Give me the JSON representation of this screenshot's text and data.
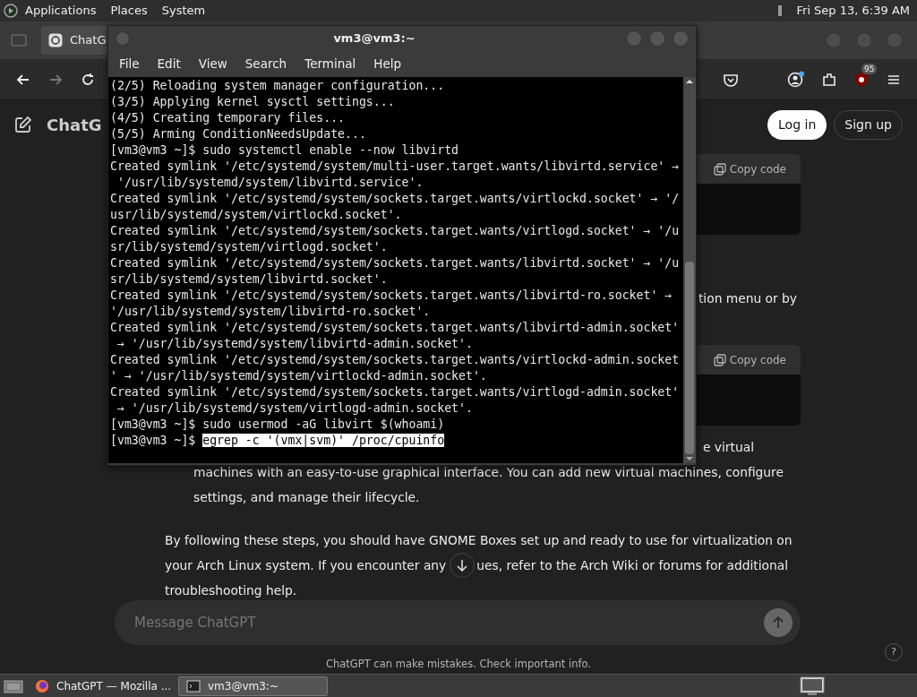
{
  "top_panel": {
    "menus": [
      "Applications",
      "Places",
      "System"
    ],
    "clock": "Fri Sep 13, 6:39 AM"
  },
  "browser": {
    "tab_title": "ChatG",
    "nav_buttons": [
      {
        "kind": "back",
        "disabled": false
      },
      {
        "kind": "forward",
        "disabled": true
      },
      {
        "kind": "reload",
        "disabled": false
      }
    ],
    "extension_badge": "95"
  },
  "chatgpt": {
    "brand": "ChatG",
    "login": "Log in",
    "signup": "Sign up",
    "code_blocks": [
      {
        "copy_label": "Copy code"
      },
      {
        "copy_label": "Copy code"
      }
    ],
    "text_fragment": "tion menu or by",
    "list_fragment": "e virtual",
    "list_continuation": "machines with an easy-to-use graphical interface. You can add new virtual machines, configure settings, and manage their lifecycle.",
    "paragraph_lines": [
      {
        "text": "By following these steps, you should have GNOME Boxes set up and ready to use for virtualization on"
      },
      {
        "text": "your Arch Linux system. If you encounter any",
        "after_button": "ues, refer to the Arch Wiki or forums for additional"
      },
      {
        "text": "troubleshooting help."
      }
    ],
    "message_placeholder": "Message ChatGPT",
    "footer": "ChatGPT can make mistakes. Check important info.",
    "help": "?"
  },
  "terminal": {
    "title": "vm3@vm3:~",
    "menus": [
      "File",
      "Edit",
      "View",
      "Search",
      "Terminal",
      "Help"
    ],
    "lines": [
      {
        "text": "(2/5) Reloading system manager configuration..."
      },
      {
        "text": "(3/5) Applying kernel sysctl settings..."
      },
      {
        "text": "(4/5) Creating temporary files..."
      },
      {
        "text": "(5/5) Arming ConditionNeedsUpdate..."
      },
      {
        "text": "[vm3@vm3 ~]$ sudo systemctl enable --now libvirtd"
      },
      {
        "text": "Created symlink '/etc/systemd/system/multi-user.target.wants/libvirtd.service' →"
      },
      {
        "text": " '/usr/lib/systemd/system/libvirtd.service'."
      },
      {
        "text": "Created symlink '/etc/systemd/system/sockets.target.wants/virtlockd.socket' → '/"
      },
      {
        "text": "usr/lib/systemd/system/virtlockd.socket'."
      },
      {
        "text": "Created symlink '/etc/systemd/system/sockets.target.wants/virtlogd.socket' → '/u"
      },
      {
        "text": "sr/lib/systemd/system/virtlogd.socket'."
      },
      {
        "text": "Created symlink '/etc/systemd/system/sockets.target.wants/libvirtd.socket' → '/u"
      },
      {
        "text": "sr/lib/systemd/system/libvirtd.socket'."
      },
      {
        "text": "Created symlink '/etc/systemd/system/sockets.target.wants/libvirtd-ro.socket' →"
      },
      {
        "text": "'/usr/lib/systemd/system/libvirtd-ro.socket'."
      },
      {
        "text": "Created symlink '/etc/systemd/system/sockets.target.wants/libvirtd-admin.socket'"
      },
      {
        "text": " → '/usr/lib/systemd/system/libvirtd-admin.socket'."
      },
      {
        "text": "Created symlink '/etc/systemd/system/sockets.target.wants/virtlockd-admin.socket"
      },
      {
        "text": "' → '/usr/lib/systemd/system/virtlockd-admin.socket'."
      },
      {
        "text": "Created symlink '/etc/systemd/system/sockets.target.wants/virtlogd-admin.socket'"
      },
      {
        "text": " → '/usr/lib/systemd/system/virtlogd-admin.socket'."
      },
      {
        "text": "[vm3@vm3 ~]$ sudo usermod -aG libvirt $(whoami)"
      },
      {
        "text": "[vm3@vm3 ~]$ ",
        "selected_text": "egrep -c '(vmx|svm)' /proc/cpuinfo"
      }
    ]
  },
  "taskbar": {
    "items": [
      {
        "kind": "browser",
        "label": "ChatGPT — Mozilla ...",
        "selected": false
      },
      {
        "kind": "terminal",
        "label": "vm3@vm3:~",
        "selected": true
      }
    ]
  }
}
